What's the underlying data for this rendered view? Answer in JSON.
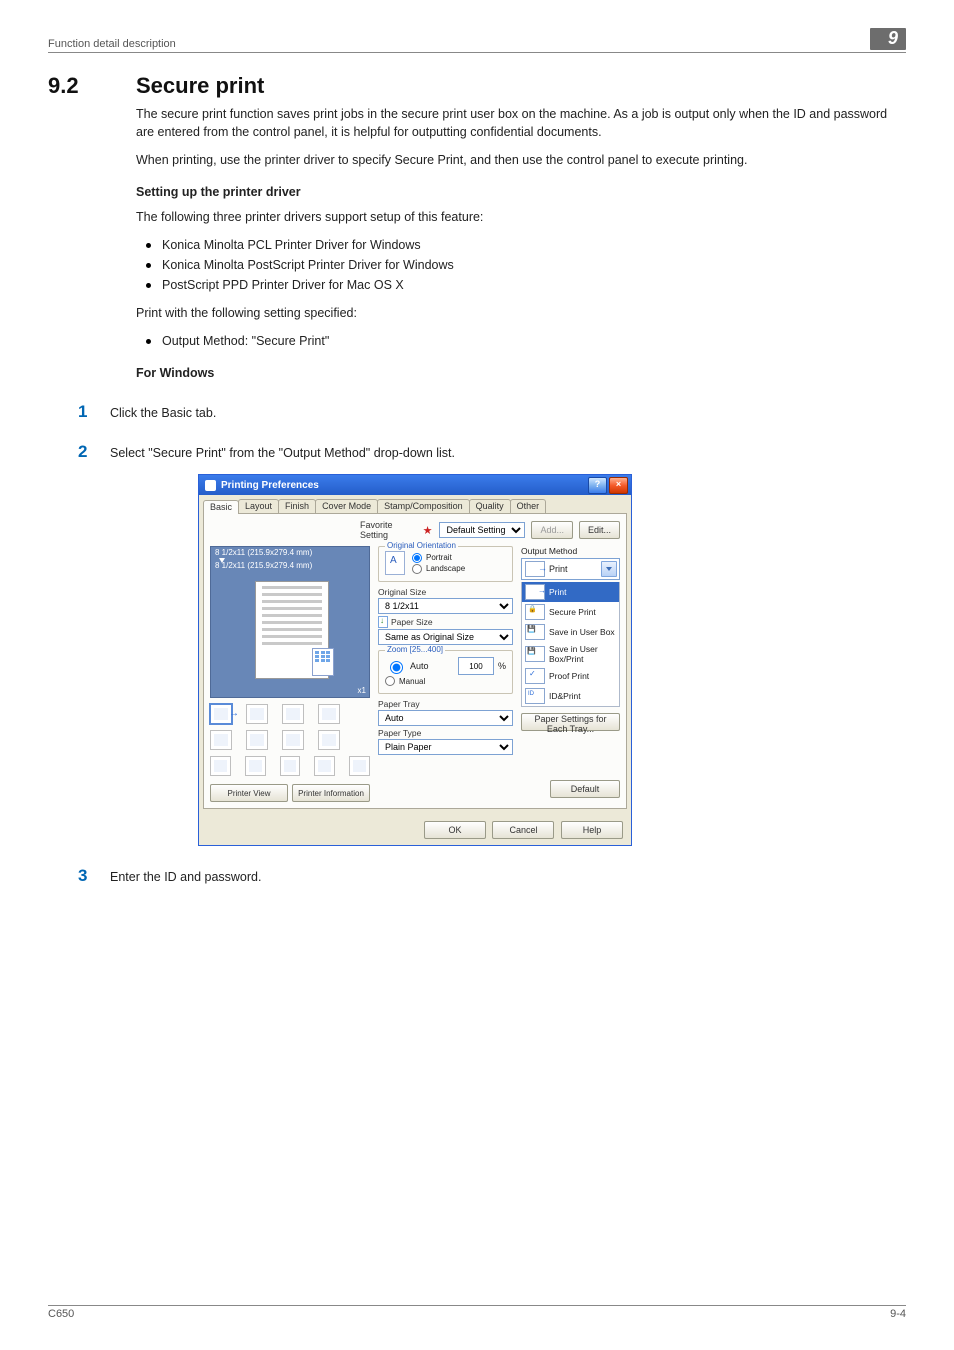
{
  "header": {
    "breadcrumb": "Function detail description",
    "chapter_badge": "9"
  },
  "section": {
    "number": "9.2",
    "title": "Secure print"
  },
  "intro": {
    "p1": "The secure print function saves print jobs in the secure print user box on the machine. As a job is output only when the ID and password are entered from the control panel, it is helpful for outputting confidential documents.",
    "p2": "When printing, use the printer driver to specify Secure Print, and then use the control panel to execute printing."
  },
  "driver_setup": {
    "heading": "Setting up the printer driver",
    "lead": "The following three printer drivers support setup of this feature:",
    "drivers": [
      "Konica Minolta PCL Printer Driver for Windows",
      "Konica Minolta PostScript Printer Driver for Windows",
      "PostScript PPD Printer Driver for Mac OS X"
    ],
    "print_with": "Print with the following setting specified:",
    "setting_line": "Output Method: \"Secure Print\""
  },
  "windows": {
    "heading": "For Windows",
    "step1": "Click the Basic tab.",
    "step2": "Select \"Secure Print\" from the \"Output Method\" drop-down list.",
    "step3": "Enter the ID and password."
  },
  "dialog": {
    "title": "Printing Preferences",
    "tabs": [
      "Basic",
      "Layout",
      "Finish",
      "Cover Mode",
      "Stamp/Composition",
      "Quality",
      "Other"
    ],
    "active_tab": 0,
    "favorite": {
      "label": "Favorite Setting",
      "value": "Default Setting",
      "add": "Add...",
      "edit": "Edit..."
    },
    "preview": {
      "line1": "8 1/2x11 (215.9x279.4 mm)",
      "line2": "8 1/2x11 (215.9x279.4 mm)",
      "ratio": "x1"
    },
    "printer_view": "Printer View",
    "printer_info": "Printer Information",
    "orientation": {
      "legend": "Original Orientation",
      "portrait": "Portrait",
      "landscape": "Landscape"
    },
    "original_size": {
      "label": "Original Size",
      "value": "8 1/2x11"
    },
    "paper_size": {
      "label": "Paper Size",
      "value": "Same as Original Size"
    },
    "zoom": {
      "legend": "Zoom [25...400]",
      "auto": "Auto",
      "manual": "Manual",
      "value": "100",
      "unit": "%"
    },
    "paper_tray": {
      "label": "Paper Tray",
      "value": "Auto"
    },
    "paper_type": {
      "label": "Paper Type",
      "value": "Plain Paper"
    },
    "output": {
      "label": "Output Method",
      "value": "Print",
      "options": [
        "Print",
        "Secure Print",
        "Save in User Box",
        "Save in User Box/Print",
        "Proof Print",
        "ID&Print"
      ]
    },
    "paper_settings_btn": "Paper Settings for Each Tray...",
    "default_btn": "Default",
    "ok": "OK",
    "cancel": "Cancel",
    "help": "Help"
  },
  "footer": {
    "model": "C650",
    "page": "9-4"
  }
}
